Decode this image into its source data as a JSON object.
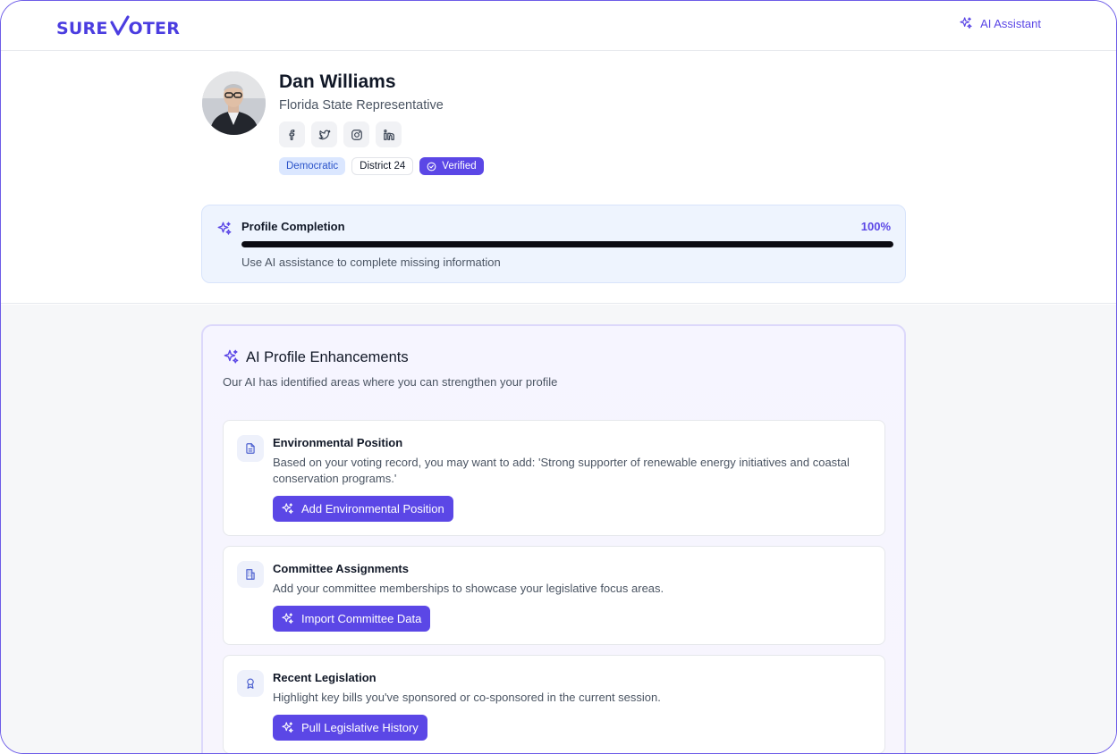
{
  "header": {
    "logo_part1": "SURE",
    "logo_part2": "OTER",
    "ai_assistant_label": "AI Assistant"
  },
  "profile": {
    "name": "Dan Williams",
    "role": "Florida State Representative",
    "socials": [
      "facebook-icon",
      "twitter-icon",
      "instagram-icon",
      "linkedin-icon"
    ],
    "badges": {
      "party": "Democratic",
      "district": "District 24",
      "verified": "Verified"
    }
  },
  "completion": {
    "title": "Profile Completion",
    "percent_label": "100%",
    "percent_value": 100,
    "hint": "Use AI assistance to complete missing information"
  },
  "enhancements": {
    "title": "AI Profile Enhancements",
    "subtitle": "Our AI has identified areas where you can strengthen your profile",
    "cards": [
      {
        "icon": "document-icon",
        "title": "Environmental Position",
        "description": "Based on your voting record, you may want to add: 'Strong supporter of renewable energy initiatives and coastal conservation programs.'",
        "button": "Add Environmental Position"
      },
      {
        "icon": "building-icon",
        "title": "Committee Assignments",
        "description": "Add your committee memberships to showcase your legislative focus areas.",
        "button": "Import Committee Data"
      },
      {
        "icon": "award-icon",
        "title": "Recent Legislation",
        "description": "Highlight key bills you've sponsored or co-sponsored in the current session.",
        "button": "Pull Legislative History"
      }
    ]
  },
  "colors": {
    "accent": "#5b47e6",
    "brand": "#4b3de0",
    "progress_fill": "#0b0b12",
    "completion_bg": "#eef4fe",
    "party_badge_bg": "#dbe7ff"
  }
}
